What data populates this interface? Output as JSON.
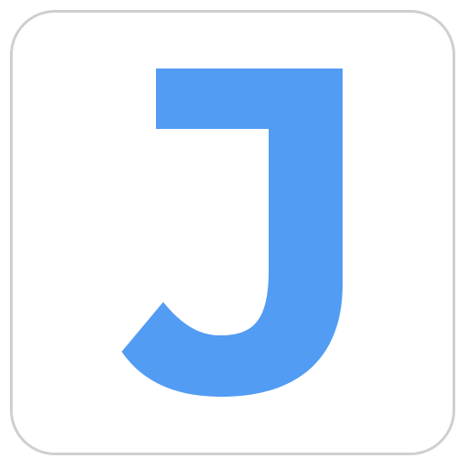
{
  "icon": {
    "letter": "J",
    "letter_color": "#529cf3",
    "border_color": "#cfcfcf",
    "background_color": "#ffffff"
  }
}
